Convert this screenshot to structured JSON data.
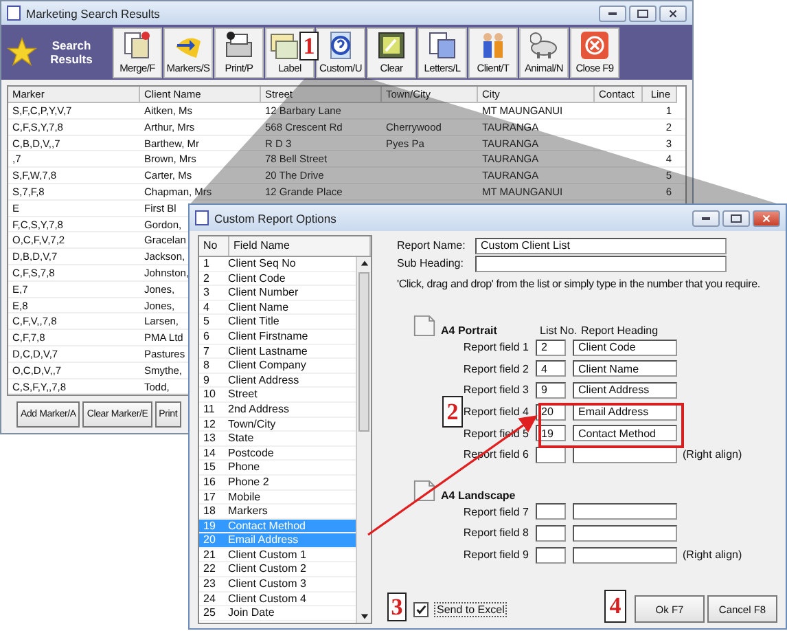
{
  "main_window": {
    "title": "Marketing Search Results",
    "toolbar_label": "Search Results",
    "toolbar": [
      {
        "label": "Merge/F"
      },
      {
        "label": "Markers/S"
      },
      {
        "label": "Print/P"
      },
      {
        "label": "Label"
      },
      {
        "label": "Custom/U"
      },
      {
        "label": "Clear"
      },
      {
        "label": "Letters/L"
      },
      {
        "label": "Client/T"
      },
      {
        "label": "Animal/N"
      },
      {
        "label": "Close F9"
      }
    ],
    "table": {
      "columns": [
        "Marker",
        "Client Name",
        "Street",
        "Town/City",
        "City",
        "Contact",
        "Line"
      ],
      "rows": [
        {
          "marker": "S,F,C,P,Y,V,7",
          "client_name": "Aitken, Ms",
          "street": "12 Barbary Lane",
          "city": "MT MAUNGANUI",
          "line": "1"
        },
        {
          "marker": "C,F,S,Y,7,8",
          "client_name": "Arthur, Mrs",
          "street": "568 Crescent Rd",
          "town_city": "Cherrywood",
          "city": "TAURANGA",
          "line": "2"
        },
        {
          "marker": "C,B,D,V,,7",
          "client_name": "Barthew, Mr",
          "street": "R D 3",
          "town_city": "Pyes Pa",
          "city": "TAURANGA",
          "line": "3"
        },
        {
          "marker": ",7",
          "client_name": "Brown, Mrs",
          "street": "78 Bell Street",
          "city": "TAURANGA",
          "line": "4"
        },
        {
          "marker": "S,F,W,7,8",
          "client_name": "Carter, Ms",
          "street": "20 The Drive",
          "city": "TAURANGA",
          "line": "5"
        },
        {
          "marker": "S,7,F,8",
          "client_name": "Chapman, Mrs",
          "street": "12 Grande Place",
          "city": "MT MAUNGANUI",
          "line": "6"
        },
        {
          "marker": "E",
          "client_name": "First Bl"
        },
        {
          "marker": "F,C,S,Y,7,8",
          "client_name": "Gordon,"
        },
        {
          "marker": "O,C,F,V,7,2",
          "client_name": "Gracelan"
        },
        {
          "marker": "D,B,D,V,7",
          "client_name": "Jackson,"
        },
        {
          "marker": "C,F,S,7,8",
          "client_name": "Johnston,"
        },
        {
          "marker": "E,7",
          "client_name": "Jones,"
        },
        {
          "marker": "E,8",
          "client_name": "Jones,"
        },
        {
          "marker": "C,F,V,,7,8",
          "client_name": "Larsen,"
        },
        {
          "marker": "C,F,7,8",
          "client_name": "PMA Ltd"
        },
        {
          "marker": "D,C,D,V,7",
          "client_name": "Pastures"
        },
        {
          "marker": "O,C,D,V,,7",
          "client_name": "Smythe,"
        },
        {
          "marker": "C,S,F,Y,,7,8",
          "client_name": "Todd,"
        }
      ]
    },
    "buttons": [
      "Add Marker/A",
      "Clear Marker/E",
      "Print"
    ]
  },
  "dialog": {
    "title": "Custom Report Options",
    "list": {
      "columns": [
        "No",
        "Field Name"
      ],
      "items": [
        {
          "no": "1",
          "name": "Client Seq No",
          "selected": false
        },
        {
          "no": "2",
          "name": "Client Code",
          "selected": false
        },
        {
          "no": "3",
          "name": "Client Number",
          "selected": false
        },
        {
          "no": "4",
          "name": "Client Name",
          "selected": false
        },
        {
          "no": "5",
          "name": "Client Title",
          "selected": false
        },
        {
          "no": "6",
          "name": "Client Firstname",
          "selected": false
        },
        {
          "no": "7",
          "name": "Client Lastname",
          "selected": false
        },
        {
          "no": "8",
          "name": "Client Company",
          "selected": false
        },
        {
          "no": "9",
          "name": "Client Address",
          "selected": false
        },
        {
          "no": "10",
          "name": "Street",
          "selected": false
        },
        {
          "no": "11",
          "name": "2nd Address",
          "selected": false
        },
        {
          "no": "12",
          "name": "Town/City",
          "selected": false
        },
        {
          "no": "13",
          "name": "State",
          "selected": false
        },
        {
          "no": "14",
          "name": "Postcode",
          "selected": false
        },
        {
          "no": "15",
          "name": "Phone",
          "selected": false
        },
        {
          "no": "16",
          "name": "Phone 2",
          "selected": false
        },
        {
          "no": "17",
          "name": "Mobile",
          "selected": false
        },
        {
          "no": "18",
          "name": "Markers",
          "selected": false
        },
        {
          "no": "19",
          "name": "Contact Method",
          "selected": true
        },
        {
          "no": "20",
          "name": "Email Address",
          "selected": true
        },
        {
          "no": "21",
          "name": "Client Custom 1",
          "selected": false
        },
        {
          "no": "22",
          "name": "Client Custom 2",
          "selected": false
        },
        {
          "no": "23",
          "name": "Client Custom 3",
          "selected": false
        },
        {
          "no": "24",
          "name": "Client Custom 4",
          "selected": false
        },
        {
          "no": "25",
          "name": "Join Date",
          "selected": false
        }
      ]
    },
    "report_name_label": "Report Name:",
    "report_name": "Custom Client List",
    "sub_heading_label": "Sub Heading:",
    "instruction": "'Click, drag and drop' from the list or simply type in the number that you require.",
    "sections": [
      {
        "title": "A4 Portrait",
        "list_no_header": "List No.",
        "heading_header": "Report Heading",
        "fields": [
          {
            "label": "Report field 1",
            "list_no": "2",
            "heading": "Client Code"
          },
          {
            "label": "Report field 2",
            "list_no": "4",
            "heading": "Client Name"
          },
          {
            "label": "Report field 3",
            "list_no": "9",
            "heading": "Client Address"
          },
          {
            "label": "Report field 4",
            "list_no": "20",
            "heading": "Email Address"
          },
          {
            "label": "Report field 5",
            "list_no": "19",
            "heading": "Contact Method"
          },
          {
            "label": "Report field 6",
            "note": "(Right align)"
          }
        ]
      },
      {
        "title": "A4 Landscape",
        "fields": [
          {
            "label": "Report field 7"
          },
          {
            "label": "Report field 8"
          },
          {
            "label": "Report field 9",
            "note": "(Right align)"
          }
        ]
      }
    ],
    "send_to_excel": {
      "label": "Send to Excel",
      "checked": true
    },
    "buttons": [
      "Ok F7",
      "Cancel F8"
    ]
  },
  "annotations": [
    "1",
    "2",
    "3",
    "4"
  ]
}
